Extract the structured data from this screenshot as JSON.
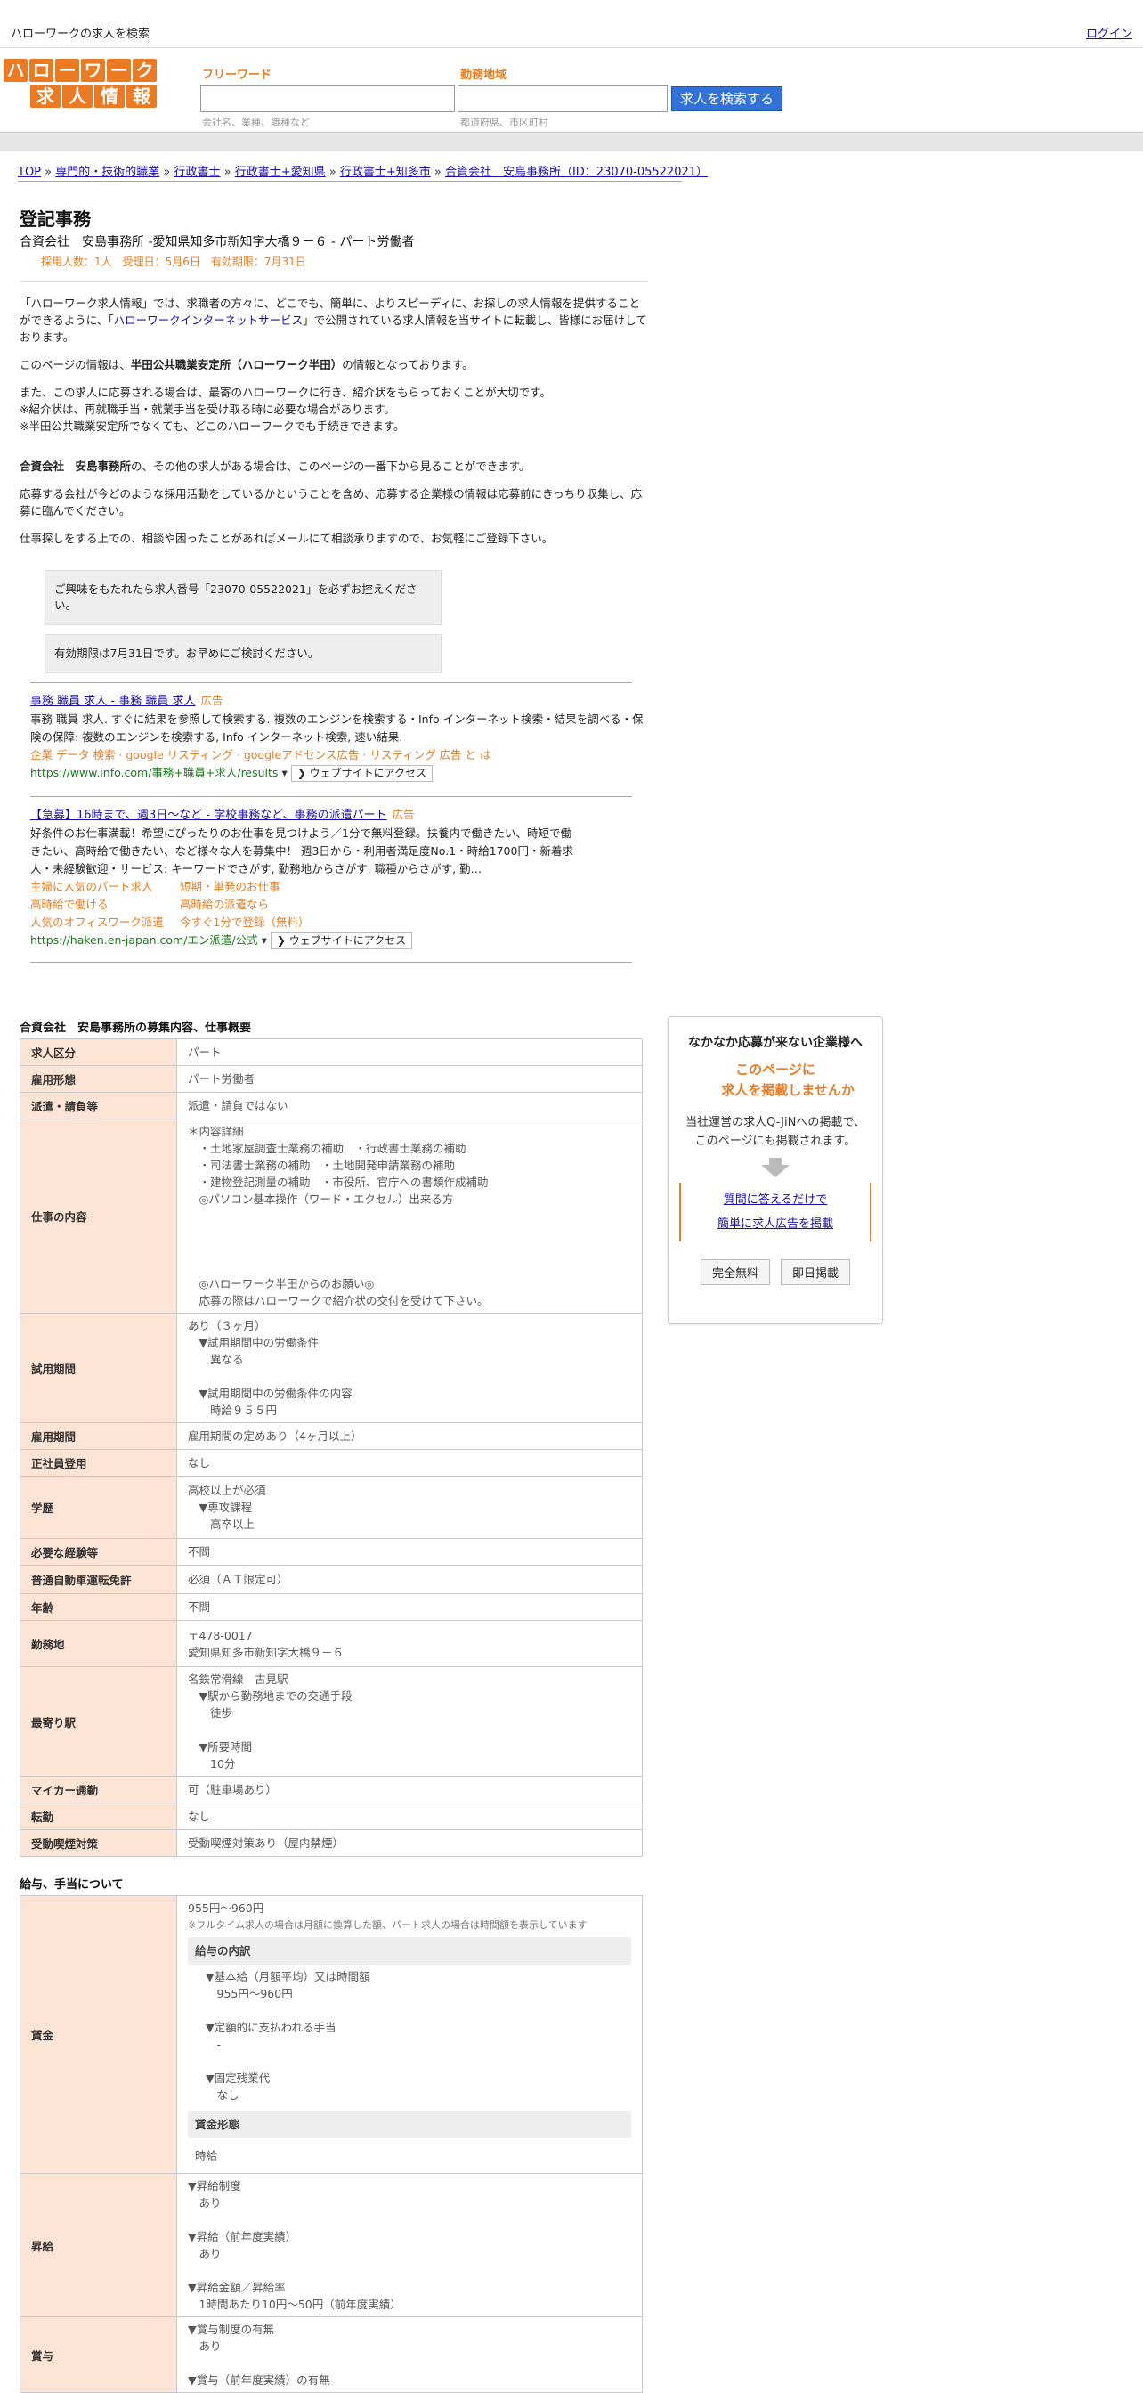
{
  "topbar": {
    "site_title": "ハローワークの求人を検索",
    "login": "ログイン"
  },
  "logo": {
    "row1": [
      "ハ",
      "ロ",
      "ー",
      "ワ",
      "ー",
      "ク"
    ],
    "row2": [
      "求",
      "人",
      "情",
      "報"
    ]
  },
  "search": {
    "freeword_label": "フリーワード",
    "freeword_hint": "会社名、業種、職種など",
    "area_label": "勤務地域",
    "area_hint": "都道府県、市区町村",
    "button": "求人を検索する"
  },
  "breadcrumb": [
    {
      "label": "TOP"
    },
    {
      "label": "専門的・技術的職業"
    },
    {
      "label": "行政書士"
    },
    {
      "label": "行政書士+愛知県"
    },
    {
      "label": "行政書士+知多市"
    },
    {
      "label": "合資会社　安島事務所（ID：23070-05522021）"
    }
  ],
  "job": {
    "title": "登記事務",
    "subtitle": "合資会社　安島事務所 -愛知県知多市新知字大橋９－６ - パート労働者",
    "meta": "採用人数：1人　受理日：5月6日　有効期限：7月31日"
  },
  "intro": {
    "p1_a": "「ハローワーク求人情報」では、求職者の方々に、どこでも、簡単に、よりスピーディに、お探しの求人情報を提供することができるように、「",
    "p1_link": "ハローワークインターネットサービス",
    "p1_b": "」で公開されている求人情報を当サイトに転載し、皆様にお届けしております。",
    "p2_a": "このページの情報は、",
    "p2_bold": "半田公共職業安定所（ハローワーク半田）",
    "p2_b": "の情報となっております。",
    "p3_1": "また、この求人に応募される場合は、最寄のハローワークに行き、紹介状をもらっておくことが大切です。",
    "p3_2": "※紹介状は、再就職手当・就業手当を受け取る時に必要な場合があります。",
    "p3_3": "※半田公共職業安定所でなくても、どこのハローワークでも手続きできます。",
    "p4_bold": "合資会社　安島事務所",
    "p4": "の、その他の求人がある場合は、このページの一番下から見ることができます。",
    "p5": "応募する会社が今どのような採用活動をしているかということを含め、応募する企業様の情報は応募前にきっちり収集し、応募に臨んでください。",
    "p6": "仕事探しをする上での、相談や困ったことがあればメールにて相談承りますので、お気軽にご登録下さい。"
  },
  "notes": [
    "ご興味をもたれたら求人番号「23070-05522021」を必ずお控えください。",
    "有効期限は7月31日です。お早めにご検討ください。"
  ],
  "ads": [
    {
      "title": "事務 職員 求人 - 事務 職員 求人",
      "tag": "広告",
      "desc": "事務 職員 求人. すぐに結果を参照して検索する. 複数のエンジンを検索する・Info インターネット検索・結果を調べる・保険の保障: 複数のエンジンを検索する, Info インターネット検索, 速い結果.",
      "orange": "企業 データ 検索 · google リスティング · googleアドセンス広告 · リスティング 広告 と は",
      "url": "https://www.info.com/事務+職員+求人/results",
      "visit": "❯ ウェブサイトにアクセス"
    },
    {
      "title": "【急募】16時まで、週3日～など - 学校事務など、事務の派遣パート",
      "tag": "広告",
      "desc": "好条件のお仕事満載！希望にぴったりのお仕事を見つけよう／1分で無料登録。扶養内で働きたい、時短で働きたい、高時給で働きたい、など様々な人を募集中！ 週3日から・利用者満足度No.1・時給1700円・新着求人・未経験歓迎・サービス: キーワードでさがす, 勤務地からさがす, 職種からさがす, 勤…",
      "links": [
        "主婦に人気のパート求人",
        "短期・単発のお仕事",
        "高時給で働ける",
        "高時給の派遣なら",
        "人気のオフィスワーク派遣",
        "今すぐ1分で登録（無料）"
      ],
      "url": "https://haken.en-japan.com/エン派遣/公式",
      "visit": "❯ ウェブサイトにアクセス"
    }
  ],
  "overview": {
    "title": "合資会社　安島事務所の募集内容、仕事概要",
    "rows": [
      {
        "k": "求人区分",
        "v": "パート"
      },
      {
        "k": "雇用形態",
        "v": "パート労働者"
      },
      {
        "k": "派遣・請負等",
        "v": "派遣・請負ではない"
      },
      {
        "k": "仕事の内容",
        "v": "＊内容詳細\n　・土地家屋調査士業務の補助　・行政書士業務の補助\n　・司法書士業務の補助　・土地開発申請業務の補助\n　・建物登記測量の補助　・市役所、官庁への書類作成補助\n　◎パソコン基本操作（ワード・エクセル）出来る方\n\n\n\n\n　◎ハローワーク半田からのお願い◎\n　応募の際はハローワークで紹介状の交付を受けて下さい。"
      },
      {
        "k": "試用期間",
        "v": "あり（３ヶ月）\n　▼試用期間中の労働条件\n　　異なる\n\n　▼試用期間中の労働条件の内容\n　　時給９５５円"
      },
      {
        "k": "雇用期間",
        "v": "雇用期間の定めあり（4ヶ月以上）"
      },
      {
        "k": "正社員登用",
        "v": "なし"
      },
      {
        "k": "学歴",
        "v": "高校以上が必須\n　▼専攻課程\n　　高卒以上"
      },
      {
        "k": "必要な経験等",
        "v": "不問"
      },
      {
        "k": "普通自動車運転免許",
        "v": "必須（ＡＴ限定可）"
      },
      {
        "k": "年齢",
        "v": "不問"
      },
      {
        "k": "勤務地",
        "v": "〒478-0017\n愛知県知多市新知字大橋９－６"
      },
      {
        "k": "最寄り駅",
        "v": "名鉄常滑線　古見駅\n　▼駅から勤務地までの交通手段\n　　徒歩\n\n　▼所要時間\n　　10分"
      },
      {
        "k": "マイカー通勤",
        "v": "可（駐車場あり）"
      },
      {
        "k": "転勤",
        "v": "なし"
      },
      {
        "k": "受動喫煙対策",
        "v": "受動喫煙対策あり（屋内禁煙）"
      }
    ]
  },
  "pay": {
    "title": "給与、手当について",
    "wage_label": "賃金",
    "wage": "955円〜960円",
    "wage_note": "※フルタイム求人の場合は月額に換算した額、パート求人の場合は時間額を表示しています",
    "breakdown_header": "給与の内訳",
    "breakdown": "▼基本給（月額平均）又は時間額\n　955円〜960円\n\n▼定額的に支払われる手当\n　-\n\n▼固定残業代\n　なし",
    "form_header": "賃金形態",
    "form": "時給",
    "raise_label": "昇給",
    "raise": "▼昇給制度\n　あり\n\n▼昇給（前年度実績）\n　あり\n\n▼昇給金額／昇給率\n　1時間あたり10円〜50円（前年度実績）",
    "bonus_label": "賞与",
    "bonus": "▼賞与制度の有無\n　あり\n\n▼賞与（前年度実績）の有無"
  },
  "sidebox": {
    "heading": "なかなか応募が来ない企業様へ",
    "orange1": "このページに",
    "orange2": "求人を掲載しませんか",
    "desc1": "当社運営の求人Q-JiNへの掲載で、",
    "desc2": "このページにも掲載されます。",
    "link1": "質問に答えるだけで",
    "link2": "簡単に求人広告を掲載",
    "btn1": "完全無料",
    "btn2": "即日掲載"
  }
}
